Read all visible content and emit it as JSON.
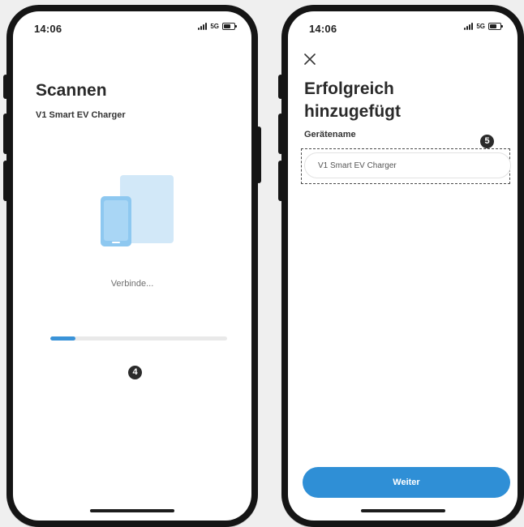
{
  "left_phone": {
    "status": {
      "time": "14:06",
      "network": "5G"
    },
    "title": "Scannen",
    "subtitle": "V1 Smart EV Charger",
    "connecting_text": "Verbinde...",
    "progress_percent": 14,
    "step_marker": "4"
  },
  "right_phone": {
    "status": {
      "time": "14:06",
      "network": "5G"
    },
    "title": "Erfolgreich hinzugefügt",
    "field_label": "Gerätename",
    "device_name_value": "V1 Smart EV Charger",
    "next_label": "Weiter",
    "step_marker": "5"
  },
  "colors": {
    "accent": "#2f8fd6",
    "progress": "#3a93d8",
    "illustration_light": "#cfe7f8",
    "illustration_dark": "#8ec8f0"
  },
  "icons": [
    "close-icon",
    "signal-icon",
    "battery-icon",
    "device-illustration-icon"
  ]
}
